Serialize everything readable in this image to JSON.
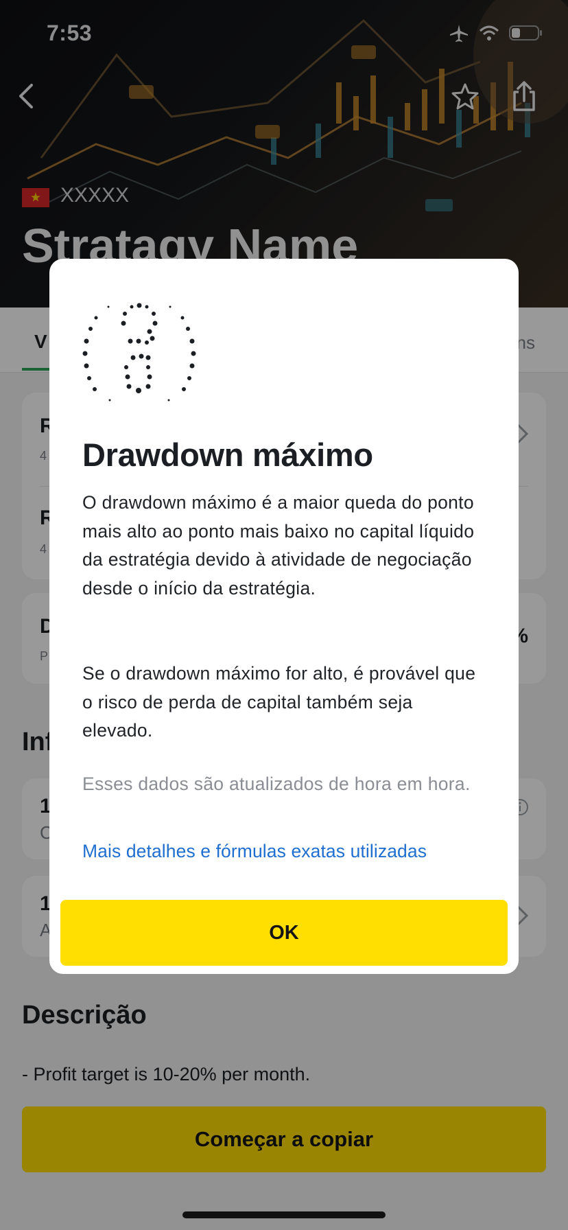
{
  "status_bar": {
    "time": "7:53"
  },
  "header": {
    "provider": "XXXXX",
    "strategy_name": "Stratagy Name"
  },
  "tabs": {
    "first_partial": "V",
    "last_partial": "ns"
  },
  "background_cards": {
    "card1_row1_title": "R",
    "card1_row1_sub": "4",
    "card1_row2_title": "R",
    "card1_row2_sub": "4",
    "card2_title": "D",
    "card2_sub": "P",
    "card2_value_partial": "%",
    "info_heading_partial": "Inf",
    "card3_title": "1",
    "card3_sub": "C",
    "card4_title": "1",
    "card4_sub": "A"
  },
  "description": {
    "title": "Descrição",
    "text": "- Profit target is 10-20% per month."
  },
  "copy_button_label": "Começar a copiar",
  "modal": {
    "title": "Drawdown máximo",
    "paragraph1": "O drawdown máximo é a maior queda do ponto mais alto ao ponto mais baixo no capital líquido da estratégia devido à atividade de negociação desde o início da estratégia.",
    "paragraph2": "Se o drawdown máximo for alto, é provável que o risco de perda de capital também seja elevado.",
    "note": "Esses dados são atualizados de hora em hora.",
    "link": "Mais detalhes e fórmulas exatas utilizadas",
    "ok_label": "OK"
  },
  "colors": {
    "accent_yellow": "#ffde02",
    "link_blue": "#1f6fd1",
    "tab_green": "#2aa35a"
  },
  "icons": [
    "back-icon",
    "star-icon",
    "share-icon",
    "airplane-icon",
    "wifi-icon",
    "battery-icon",
    "flag-icon",
    "drawdown-illustration",
    "info-icon",
    "chevron-right-icon"
  ]
}
